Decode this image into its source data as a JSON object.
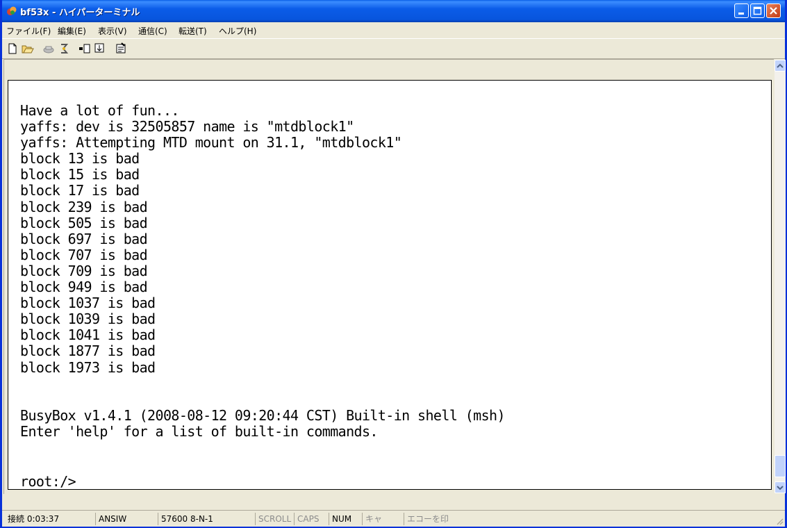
{
  "window": {
    "title": "bf53x - ハイパーターミナル",
    "accent": "#0831d9"
  },
  "menu": {
    "items": [
      "ファイル(F)",
      "編集(E)",
      "表示(V)",
      "通信(C)",
      "転送(T)",
      "ヘルプ(H)"
    ]
  },
  "toolbar": {
    "icons": [
      "new-document-icon",
      "open-folder-icon",
      "phone-icon",
      "disconnect-icon",
      "send-icon",
      "receive-icon",
      "properties-icon"
    ]
  },
  "terminal": {
    "text": "Have a lot of fun...\nyaffs: dev is 32505857 name is \"mtdblock1\"\nyaffs: Attempting MTD mount on 31.1, \"mtdblock1\"\nblock 13 is bad\nblock 15 is bad\nblock 17 is bad\nblock 239 is bad\nblock 505 is bad\nblock 697 is bad\nblock 707 is bad\nblock 709 is bad\nblock 949 is bad\nblock 1037 is bad\nblock 1039 is bad\nblock 1041 is bad\nblock 1877 is bad\nblock 1973 is bad\n\n\nBusyBox v1.4.1 (2008-08-12 09:20:44 CST) Built-in shell (msh)\nEnter 'help' for a list of built-in commands.",
    "prompt": "root:/>"
  },
  "status": {
    "connected": "接続 0:03:37",
    "emulation": "ANSIW",
    "port": "57600 8-N-1",
    "scroll": "SCROLL",
    "caps": "CAPS",
    "num": "NUM",
    "kana": "キャ",
    "echo": "エコーを印"
  }
}
